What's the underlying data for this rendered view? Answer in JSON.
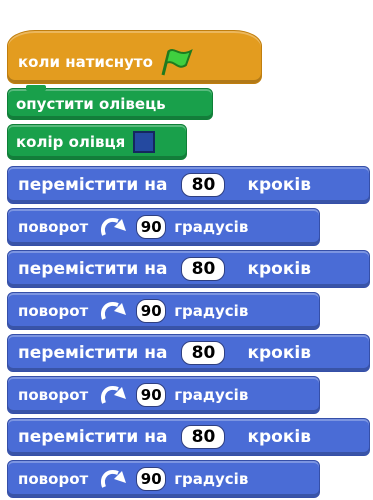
{
  "script": {
    "hat": {
      "label": "коли натиснуто",
      "icon": "green-flag-icon"
    },
    "pen_down": {
      "label": "опустити олівець"
    },
    "pen_color": {
      "label": "колір олівця",
      "color": "#2449a0"
    },
    "move": {
      "label": "перемістити на",
      "value": "80",
      "unit": "кроків"
    },
    "turn": {
      "label": "поворот",
      "icon": "turn-right-icon",
      "value": "90",
      "unit": "градусів"
    }
  },
  "colors": {
    "events": "#e39c1f",
    "pen": "#19a04b",
    "motion": "#4a6cd6"
  }
}
